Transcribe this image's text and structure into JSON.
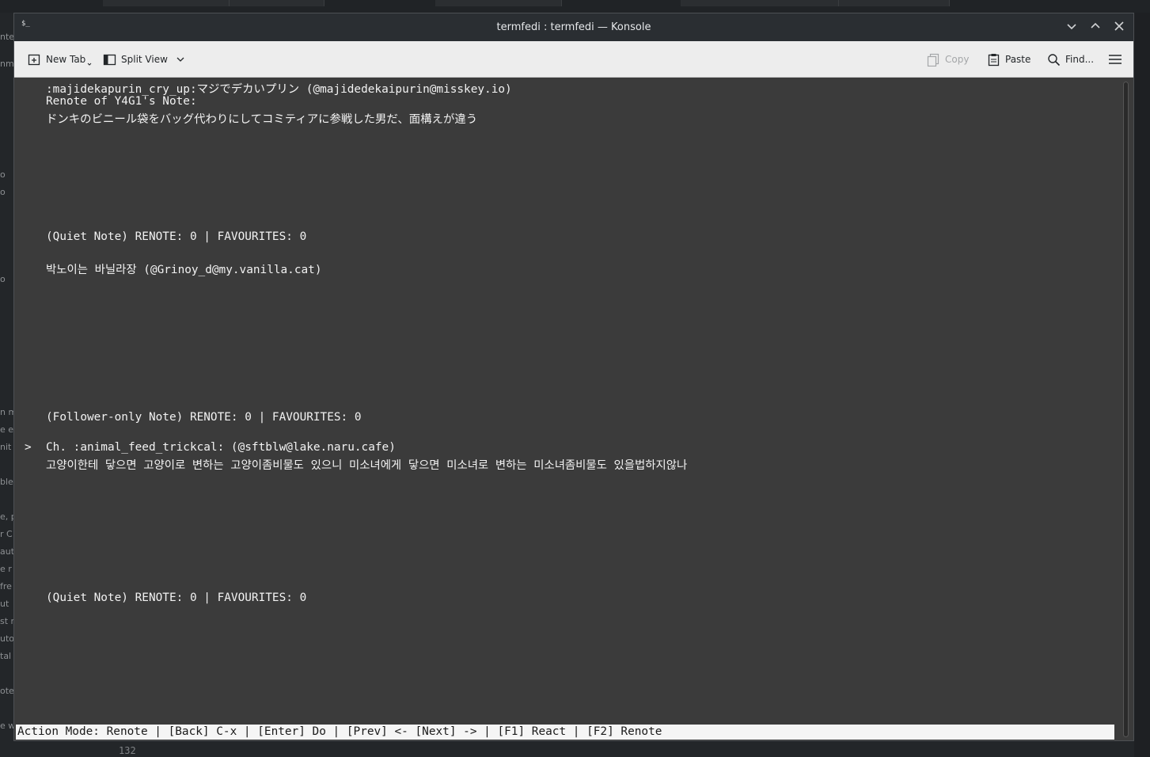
{
  "window": {
    "title": "termfedi : termfedi — Konsole",
    "icon": "terminal-icon"
  },
  "toolbar": {
    "new_tab": "New Tab",
    "split_view": "Split View",
    "copy": "Copy",
    "paste": "Paste",
    "find": "Find..."
  },
  "terminal": {
    "lines": [
      ":majidekapurin_cry_up:マジでデカいプリン (@majidedekaipurin@misskey.io)",
      "Renote of Y4G1's Note:",
      "ドンキのビニール袋をバッグ代わりにしてコミティアに参戦した男だ、面構えが違う",
      "(Quiet Note) RENOTE: 0 | FAVOURITES: 0",
      "박노이는 바닐라장 (@Grinoy_d@my.vanilla.cat)",
      "(Follower-only Note) RENOTE: 0 | FAVOURITES: 0",
      "Ch. :animal_feed_trickcal: (@sftblw@lake.naru.cafe)",
      "고양이한테 닿으면 고양이로 변하는 고양이좀비물도 있으니 미소녀에게 닿으면 미소녀로 변하는 미소녀좀비물도 있을법하지않나",
      "(Quiet Note) RENOTE: 0 | FAVOURITES: 0"
    ],
    "selection_marker": ">",
    "status": "Action Mode: Renote | [Back] C-x | [Enter] Do | [Prev] <- [Next] -> | [F1] React | [F2] Renote"
  },
  "background": {
    "line_number": "132"
  }
}
